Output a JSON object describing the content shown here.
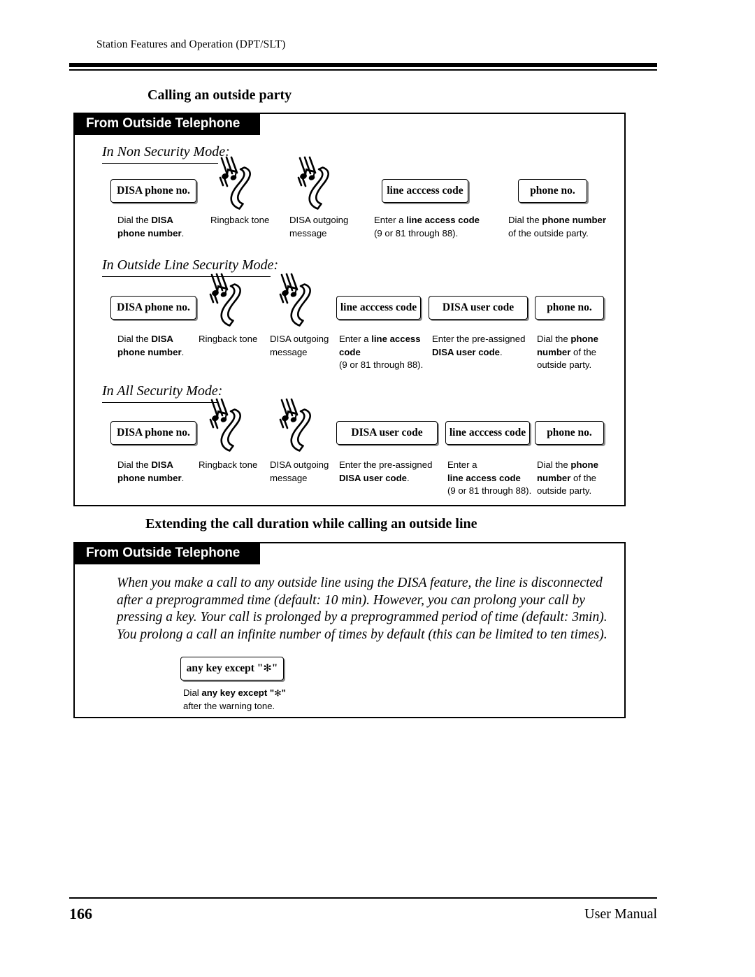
{
  "header": {
    "running_head": "Station Features and Operation (DPT/SLT)"
  },
  "footer": {
    "page_number": "166",
    "manual_label": "User Manual"
  },
  "sections": [
    {
      "title": "Calling an outside party",
      "banner": "From Outside Telephone",
      "modes": [
        {
          "heading": "In Non Security Mode:",
          "steps": [
            {
              "type": "box",
              "box_label": "DISA phone no.",
              "caption_lines": [
                "Dial the |DISA",
                "|phone number|."
              ]
            },
            {
              "type": "icon",
              "icon": "telephone-handset-ringing-icon",
              "caption_lines": [
                "Ringback tone"
              ]
            },
            {
              "type": "icon",
              "icon": "telephone-handset-ringing-icon",
              "caption_lines": [
                "DISA outgoing",
                "message"
              ]
            },
            {
              "type": "box",
              "box_label": "line acccess code",
              "caption_lines": [
                "Enter a |line access code",
                "(9 or 81 through 88)."
              ]
            },
            {
              "type": "box",
              "box_label": "phone no.",
              "caption_lines": [
                "Dial the |phone number",
                "of the outside party."
              ]
            }
          ]
        },
        {
          "heading": "In Outside Line Security Mode:",
          "steps": [
            {
              "type": "box",
              "box_label": "DISA phone no.",
              "caption_lines": [
                "Dial the |DISA",
                "|phone number|."
              ]
            },
            {
              "type": "icon",
              "icon": "telephone-handset-ringing-icon",
              "caption_lines": [
                "Ringback tone"
              ]
            },
            {
              "type": "icon",
              "icon": "telephone-handset-ringing-icon",
              "caption_lines": [
                "DISA outgoing",
                "message"
              ]
            },
            {
              "type": "box",
              "box_label": "line acccess code",
              "caption_lines": [
                "Enter a |line access",
                "|code",
                "(9 or 81 through 88)."
              ]
            },
            {
              "type": "box",
              "box_label": "DISA user code",
              "caption_lines": [
                "Enter the pre-assigned",
                "|DISA user code|."
              ]
            },
            {
              "type": "box",
              "box_label": "phone no.",
              "caption_lines": [
                "Dial the |phone",
                "|number| of the",
                "outside party."
              ]
            }
          ]
        },
        {
          "heading": "In All Security Mode:",
          "steps": [
            {
              "type": "box",
              "box_label": "DISA phone no.",
              "caption_lines": [
                "Dial the |DISA",
                "|phone number|."
              ]
            },
            {
              "type": "icon",
              "icon": "telephone-handset-ringing-icon",
              "caption_lines": [
                "Ringback tone"
              ]
            },
            {
              "type": "icon",
              "icon": "telephone-handset-ringing-icon",
              "caption_lines": [
                "DISA outgoing",
                "message"
              ]
            },
            {
              "type": "box",
              "box_label": "DISA user code",
              "caption_lines": [
                "Enter the pre-assigned",
                "|DISA user code|."
              ]
            },
            {
              "type": "box",
              "box_label": "line acccess code",
              "caption_lines": [
                "Enter a",
                "|line access code",
                "(9 or 81 through 88)."
              ]
            },
            {
              "type": "box",
              "box_label": "phone no.",
              "caption_lines": [
                "Dial the |phone",
                "|number| of the",
                "outside party."
              ]
            }
          ]
        }
      ]
    },
    {
      "title": "Extending the call duration while calling an outside line",
      "banner": "From Outside Telephone",
      "paragraph": "When you make a call to any outside line using the DISA feature, the line is disconnected after a preprogrammed time (default: 10 min). However, you can prolong your call by pressing a key. Your call is prolonged by a preprogrammed period of time (default: 3min). You prolong a call an infinite number of times by default (this can be limited to ten times).",
      "steps": [
        {
          "type": "box",
          "box_label_prefix": "any key except \"",
          "box_label_star": "✻",
          "box_label_suffix": "\"",
          "caption_prefix": "Dial ",
          "caption_bold": "any key except \"✻\"",
          "caption_line2": "after the warning tone."
        }
      ]
    }
  ],
  "labels": {
    "box_1_1": "DISA phone no.",
    "box_1_4": "line acccess code",
    "box_1_5": "phone no.",
    "box_2_1": "DISA phone no.",
    "box_2_4": "line acccess code",
    "box_2_5": "DISA user code",
    "box_2_6": "phone no.",
    "box_3_1": "DISA phone no.",
    "box_3_4": "DISA user code",
    "box_3_5": "line acccess code",
    "box_3_6": "phone no."
  },
  "captions": {
    "c1_1a": "Dial the ",
    "c1_1b": "DISA",
    "c1_1c": "phone number",
    "c1_1d": ".",
    "c1_2": "Ringback tone",
    "c1_3a": "DISA outgoing",
    "c1_3b": "message",
    "c1_4a": "Enter a ",
    "c1_4b": "line access code",
    "c1_4c": "(9 or 81 through 88).",
    "c1_5a": "Dial the ",
    "c1_5b": "phone number",
    "c1_5c": "of the outside party.",
    "c2_4a": "Enter a ",
    "c2_4b": "line access",
    "c2_4c": "code",
    "c2_4d": "(9 or 81 through 88).",
    "c2_5a": "Enter the pre-assigned",
    "c2_5b": "DISA user code",
    "c2_5c": ".",
    "c2_6a": "Dial the ",
    "c2_6b": "phone",
    "c2_6c": "number",
    "c2_6d": " of the",
    "c2_6e": "outside party.",
    "c3_4a": "Enter the pre-assigned",
    "c3_4b": "DISA user code",
    "c3_4c": ".",
    "c3_5a": "Enter a",
    "c3_5b": "line access code",
    "c3_5c": "(9 or 81 through 88).",
    "c3_6a": "Dial the ",
    "c3_6b": "phone",
    "c3_6c": "number",
    "c3_6d": " of the",
    "c3_6e": "outside party.",
    "c4_1a": "Dial ",
    "c4_1b": "any key except \"",
    "c4_1c": "✻",
    "c4_1d": "\"",
    "c4_1e": "after the warning tone."
  },
  "colors": {
    "ink": "#000000",
    "paper": "#ffffff",
    "banner_bg": "#000000",
    "banner_fg": "#ffffff"
  }
}
